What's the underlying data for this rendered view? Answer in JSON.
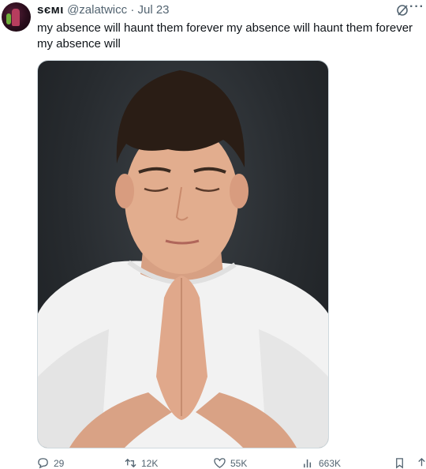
{
  "tweet": {
    "display_name": "ѕємι",
    "handle": "@zalatwicc",
    "separator": "·",
    "date": "Jul 23",
    "text": "my absence will haunt them forever my absence will haunt them forever my absence will",
    "more_label": "···"
  },
  "actions": {
    "replies": "29",
    "retweets": "12K",
    "likes": "55K",
    "views": "663K"
  },
  "media": {
    "description_icon": "photo"
  }
}
